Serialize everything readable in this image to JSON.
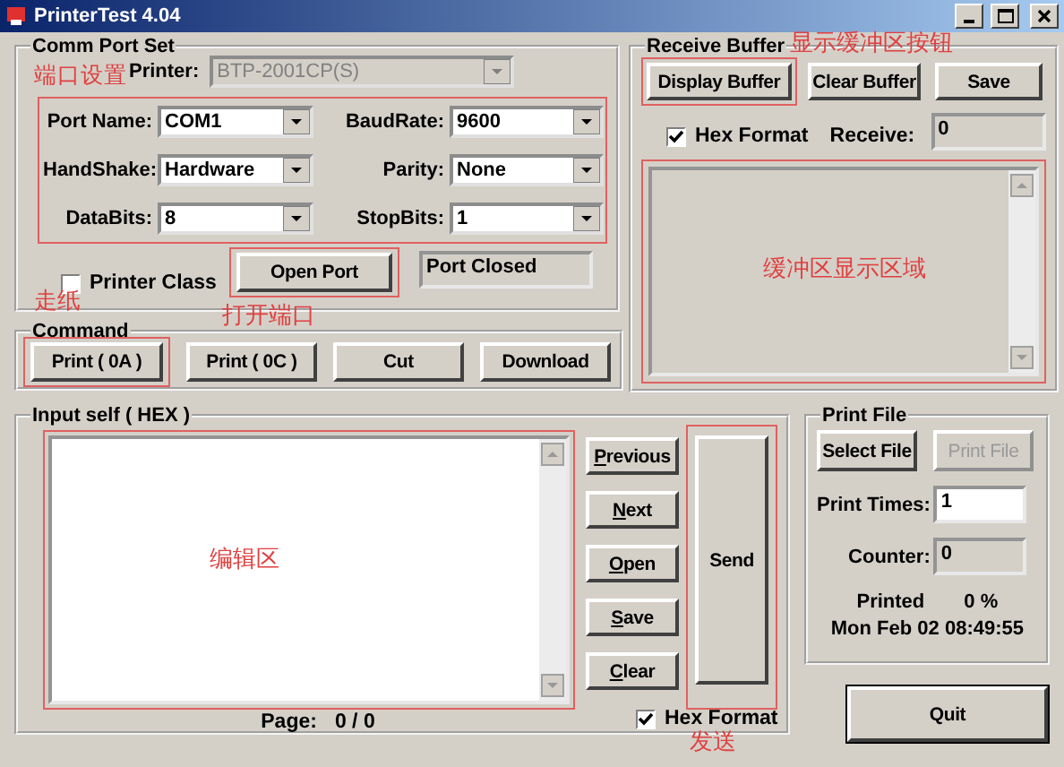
{
  "window": {
    "title": "PrinterTest  4.04"
  },
  "comm_port_set": {
    "title": "Comm Port Set",
    "printer": {
      "label": "Printer:",
      "value": "BTP-2001CP(S)",
      "disabled": true
    },
    "fields": [
      {
        "label": "Port Name:",
        "value": "COM1"
      },
      {
        "label": "BaudRate:",
        "value": "9600"
      },
      {
        "label": "HandShake:",
        "value": "Hardware"
      },
      {
        "label": "Parity:",
        "value": "None"
      },
      {
        "label": "DataBits:",
        "value": "8"
      },
      {
        "label": "StopBits:",
        "value": "1"
      }
    ],
    "printer_class": {
      "label": "Printer Class",
      "checked": false
    },
    "open_port": "Open Port",
    "status": "Port Closed"
  },
  "command": {
    "title": "Command",
    "buttons": [
      "Print ( 0A )",
      "Print ( 0C )",
      "Cut",
      "Download"
    ]
  },
  "receive_buffer": {
    "title": "Receive Buffer",
    "buttons": [
      "Display Buffer",
      "Clear Buffer",
      "Save"
    ],
    "hex_format": {
      "label": "Hex Format",
      "checked": true
    },
    "receive": {
      "label": "Receive:",
      "value": "0"
    }
  },
  "input_self": {
    "title": "Input self ( HEX )",
    "page": {
      "label": "Page:",
      "value": "0 / 0"
    },
    "nav_buttons": [
      "Previous",
      "Next",
      "Open",
      "Save",
      "Clear"
    ],
    "send": "Send",
    "hex_format": {
      "label": "Hex Format",
      "checked": true
    }
  },
  "print_file": {
    "title": "Print File",
    "buttons": [
      {
        "label": "Select File",
        "disabled": false
      },
      {
        "label": "Print File",
        "disabled": true
      }
    ],
    "print_times": {
      "label": "Print Times:",
      "value": "1"
    },
    "counter": {
      "label": "Counter:",
      "value": "0"
    },
    "printed": {
      "label": "Printed",
      "value": "0 %"
    },
    "datetime": "Mon Feb 02 08:49:55"
  },
  "quit": "Quit",
  "annotations": [
    "端口设置",
    "显示缓冲区按钮",
    "缓冲区显示区域",
    "走纸",
    "打开端口",
    "编辑区",
    "发送"
  ]
}
